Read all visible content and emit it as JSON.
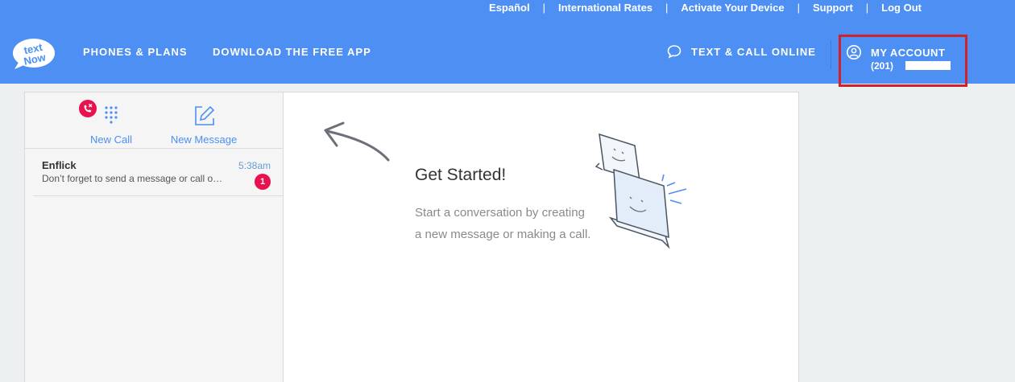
{
  "topbar": {
    "links": [
      "Español",
      "International Rates",
      "Activate Your Device",
      "Support",
      "Log Out"
    ],
    "separator": "|"
  },
  "nav": {
    "logo_alt": "textNow",
    "phones_plans": "PHONES & PLANS",
    "download_app": "DOWNLOAD THE FREE APP",
    "text_call_online": "TEXT & CALL ONLINE",
    "account_title": "MY ACCOUNT",
    "account_phone": "(201)"
  },
  "sidebar": {
    "new_call": "New Call",
    "new_message": "New Message",
    "conversations": [
      {
        "name": "Enflick",
        "time": "5:38am",
        "preview": "Don’t forget to send a message or call o…",
        "unread": "1"
      }
    ]
  },
  "main": {
    "title": "Get Started!",
    "line1": "Start a conversation by creating",
    "line2": "a new message or making a call."
  },
  "colors": {
    "brand_blue": "#4d8ff3",
    "alert_red": "#e8124f",
    "highlight_box": "#d1212a"
  },
  "icons": [
    "chat-bubble-icon",
    "user-circle-icon",
    "phone-missed-icon",
    "dialpad-icon",
    "compose-icon",
    "arrow-icon",
    "chat-bubbles-illustration"
  ]
}
